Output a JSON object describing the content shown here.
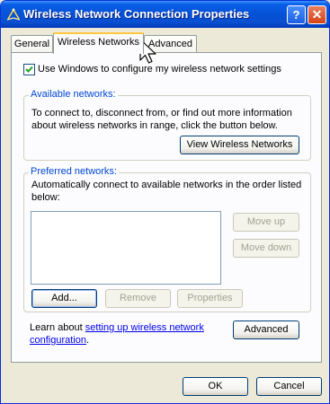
{
  "window": {
    "title": "Wireless Network Connection Properties",
    "help_label": "?",
    "close_label": "✕"
  },
  "tabs": [
    {
      "label": "General"
    },
    {
      "label": "Wireless Networks",
      "selected": true
    },
    {
      "label": "Advanced"
    }
  ],
  "use_windows_checkbox": {
    "label": "Use Windows to configure my wireless network settings",
    "checked": true
  },
  "available_networks": {
    "title": "Available networks:",
    "description_line1": "To connect to, disconnect from, or find out more information",
    "description_line2": "about wireless networks in range, click the button below.",
    "view_button": "View Wireless Networks"
  },
  "preferred_networks": {
    "title": "Preferred networks:",
    "description_line1": "Automatically connect to available networks in the order listed",
    "description_line2": "below:",
    "move_up_button": "Move up",
    "move_down_button": "Move down",
    "add_button": "Add...",
    "remove_button": "Remove",
    "properties_button": "Properties"
  },
  "learn": {
    "prefix": "Learn about ",
    "link_line1": "setting up wireless network",
    "link_line2": "configuration",
    "suffix": "."
  },
  "advanced_button": "Advanced",
  "dialog_buttons": {
    "ok": "OK",
    "cancel": "Cancel"
  },
  "colors": {
    "titlebar": "#0553d8",
    "group_title": "#0046d5",
    "link": "#0000ee",
    "panel": "#fcfcfe",
    "window": "#ece9d8"
  }
}
